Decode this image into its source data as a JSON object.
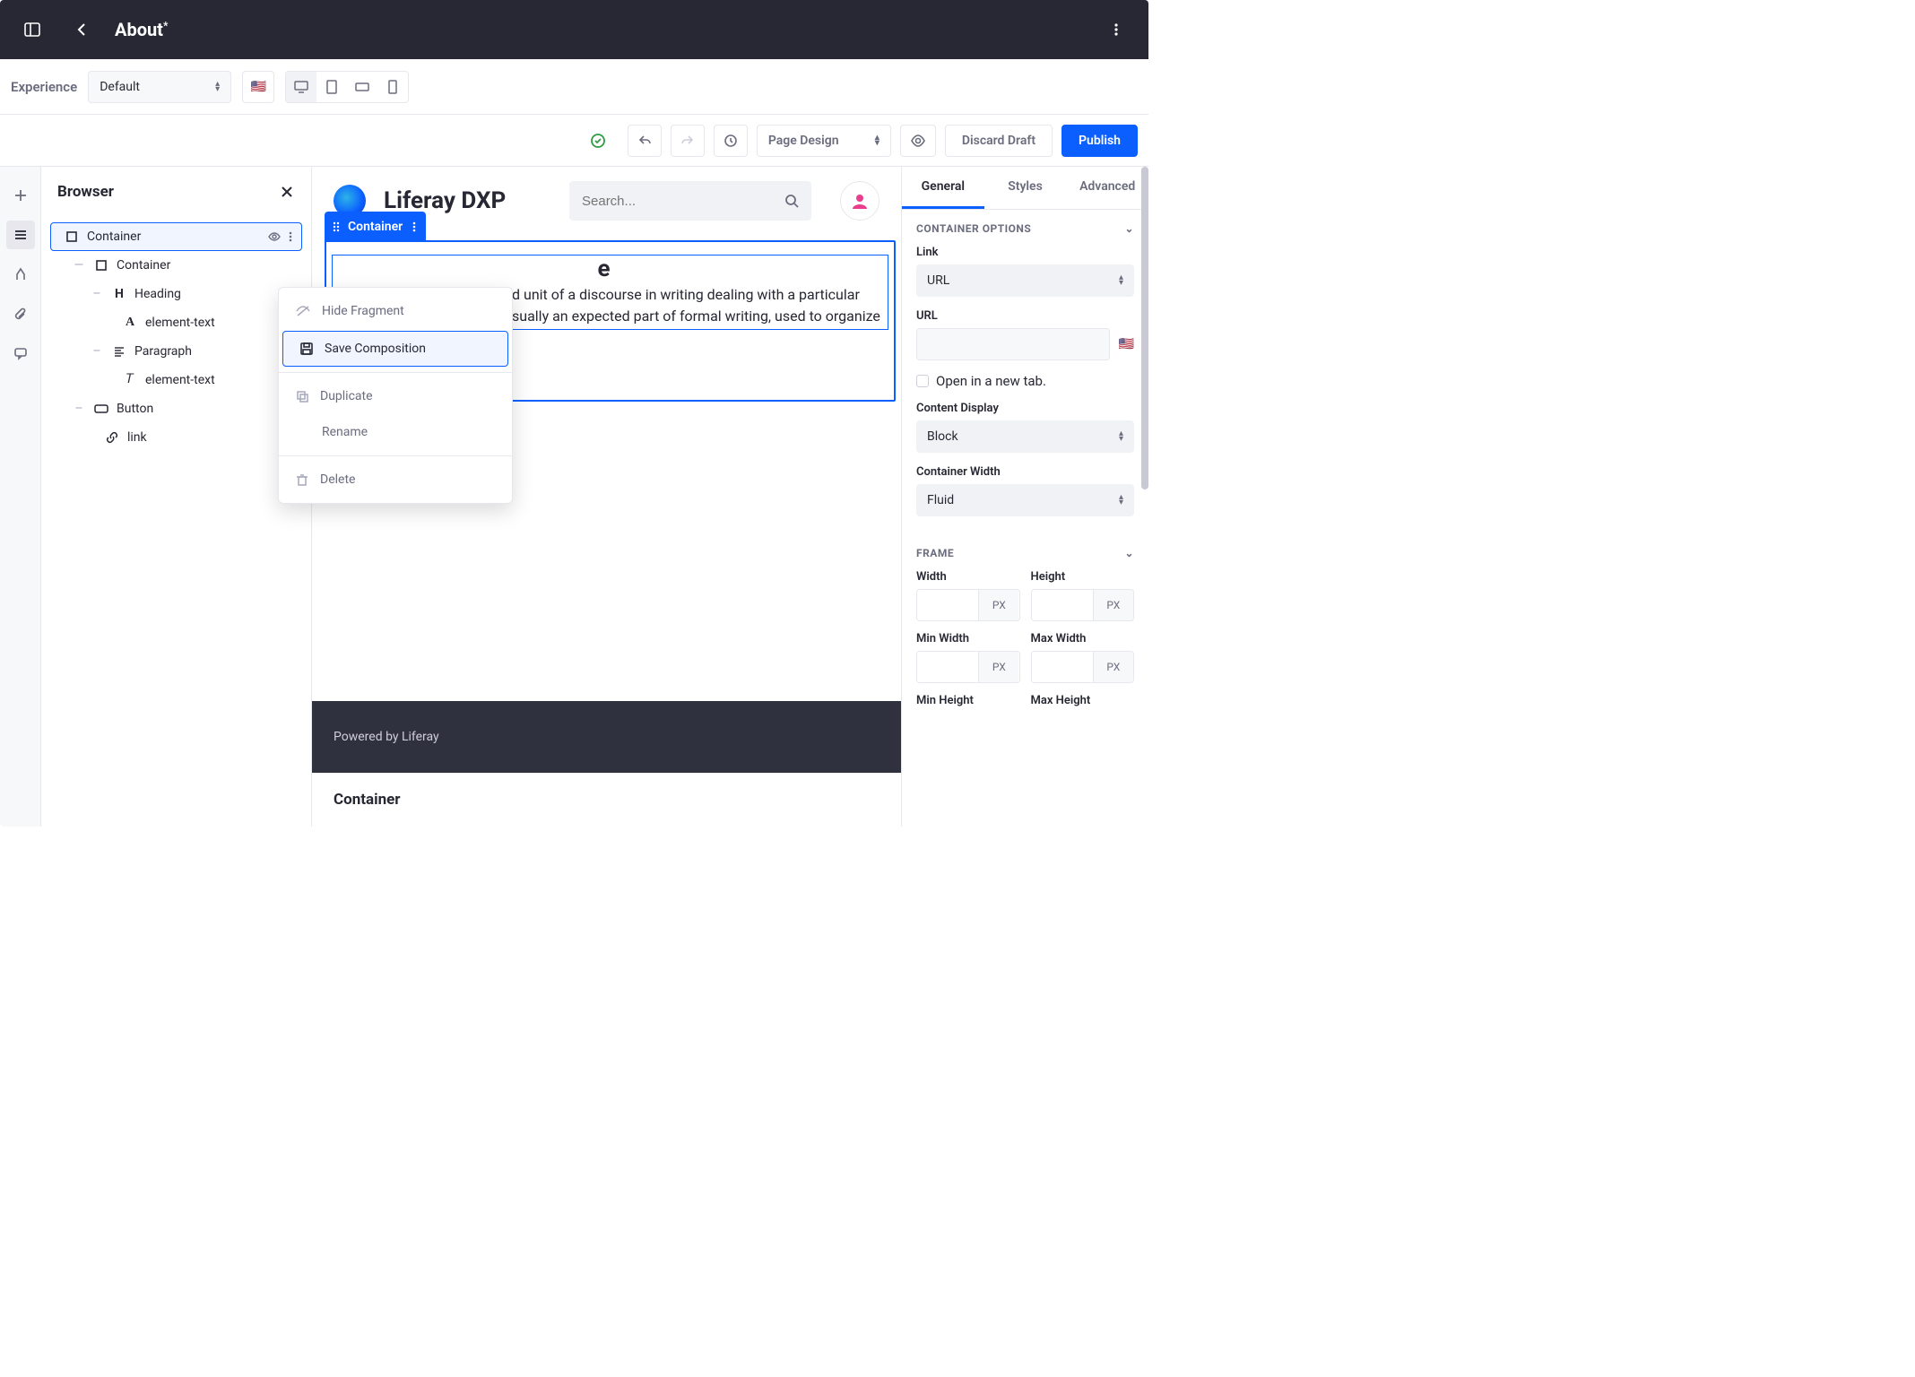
{
  "header": {
    "title": "About",
    "modified": "*"
  },
  "toolbar": {
    "experience_label": "Experience",
    "experience_value": "Default",
    "page_mode": "Page Design",
    "discard": "Discard Draft",
    "publish": "Publish"
  },
  "panel": {
    "title": "Browser",
    "tree": [
      {
        "label": "Container",
        "depth": 0,
        "icon": "square",
        "selected": true,
        "actions": true
      },
      {
        "label": "Container",
        "depth": 1,
        "icon": "square",
        "toggle": "—"
      },
      {
        "label": "Heading",
        "depth": 2,
        "icon": "H",
        "toggle": "–"
      },
      {
        "label": "element-text",
        "depth": 3,
        "icon": "A"
      },
      {
        "label": "Paragraph",
        "depth": 2,
        "icon": "para",
        "toggle": "–"
      },
      {
        "label": "element-text",
        "depth": 3,
        "icon": "T"
      },
      {
        "label": "Button",
        "depth": 1,
        "icon": "btn",
        "toggle": "–"
      },
      {
        "label": "link",
        "depth": 2,
        "icon": "link"
      }
    ]
  },
  "contextmenu": {
    "hide": "Hide Fragment",
    "save": "Save Composition",
    "duplicate": "Duplicate",
    "rename": "Rename",
    "delete": "Delete"
  },
  "canvas": {
    "brand": "Liferay DXP",
    "search_placeholder": "Search...",
    "selected_label": "Container",
    "heading_partial": "e",
    "paragraph_partial": "d unit of a discourse in writing dealing with a particular sually an expected part of formal writing, used to organize",
    "footer": "Powered by Liferay",
    "bottom_label": "Container"
  },
  "config": {
    "tabs": {
      "general": "General",
      "styles": "Styles",
      "advanced": "Advanced"
    },
    "section_container": "CONTAINER OPTIONS",
    "link_label": "Link",
    "link_value": "URL",
    "url_label": "URL",
    "open_new_tab": "Open in a new tab.",
    "content_display_label": "Content Display",
    "content_display_value": "Block",
    "container_width_label": "Container Width",
    "container_width_value": "Fluid",
    "section_frame": "FRAME",
    "width": "Width",
    "height": "Height",
    "min_width": "Min Width",
    "max_width": "Max Width",
    "min_height": "Min Height",
    "max_height": "Max Height",
    "unit": "PX"
  }
}
